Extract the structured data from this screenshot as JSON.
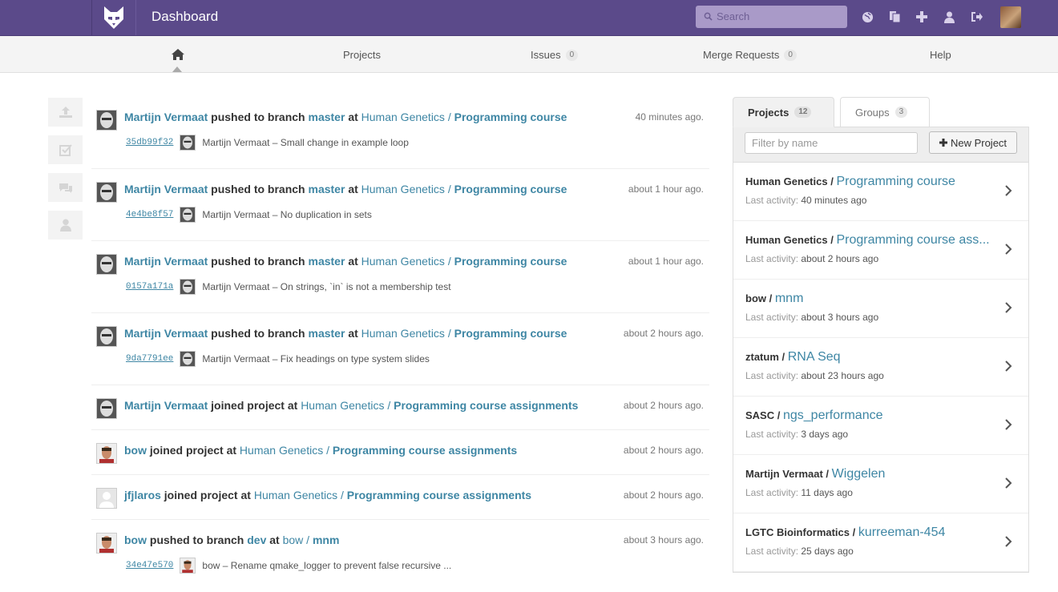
{
  "app": {
    "title": "Dashboard"
  },
  "search": {
    "placeholder": "Search"
  },
  "nav": {
    "items": [
      {
        "label": "Projects"
      },
      {
        "label": "Issues",
        "count": "0"
      },
      {
        "label": "Merge Requests",
        "count": "0"
      },
      {
        "label": "Help"
      }
    ]
  },
  "events": [
    {
      "user": "Martijn Vermaat",
      "action": "pushed to branch",
      "branch": "master",
      "at": "at",
      "namespace": "Human Genetics /",
      "project": "Programming course",
      "time": "40 minutes ago.",
      "sha": "35db99f32",
      "commit_author": "Martijn Vermaat",
      "commit_msg": "Small change in example loop"
    },
    {
      "user": "Martijn Vermaat",
      "action": "pushed to branch",
      "branch": "master",
      "at": "at",
      "namespace": "Human Genetics /",
      "project": "Programming course",
      "time": "about 1 hour ago.",
      "sha": "4e4be8f57",
      "commit_author": "Martijn Vermaat",
      "commit_msg": "No duplication in sets"
    },
    {
      "user": "Martijn Vermaat",
      "action": "pushed to branch",
      "branch": "master",
      "at": "at",
      "namespace": "Human Genetics /",
      "project": "Programming course",
      "time": "about 1 hour ago.",
      "sha": "0157a171a",
      "commit_author": "Martijn Vermaat",
      "commit_msg": "On strings, `in` is not a membership test"
    },
    {
      "user": "Martijn Vermaat",
      "action": "pushed to branch",
      "branch": "master",
      "at": "at",
      "namespace": "Human Genetics /",
      "project": "Programming course",
      "time": "about 2 hours ago.",
      "sha": "9da7791ee",
      "commit_author": "Martijn Vermaat",
      "commit_msg": "Fix headings on type system slides"
    },
    {
      "user": "Martijn Vermaat",
      "action": "joined project",
      "at": "at",
      "namespace": "Human Genetics /",
      "project": "Programming course assignments",
      "time": "about 2 hours ago."
    },
    {
      "user": "bow",
      "action": "joined project",
      "at": "at",
      "namespace": "Human Genetics /",
      "project": "Programming course assignments",
      "time": "about 2 hours ago."
    },
    {
      "user": "jfjlaros",
      "action": "joined project",
      "at": "at",
      "namespace": "Human Genetics /",
      "project": "Programming course assignments",
      "time": "about 2 hours ago."
    },
    {
      "user": "bow",
      "action": "pushed to branch",
      "branch": "dev",
      "at": "at",
      "namespace": "bow /",
      "project": "mnm",
      "time": "about 3 hours ago.",
      "sha": "34e47e570",
      "commit_author": "bow",
      "commit_msg": "Rename qmake_logger to prevent false recursive ..."
    }
  ],
  "sidebar": {
    "tab_projects": "Projects",
    "tab_projects_count": "12",
    "tab_groups": "Groups",
    "tab_groups_count": "3",
    "filter_placeholder": "Filter by name",
    "new_project_label": "New Project",
    "activity_label": "Last activity:",
    "projects": [
      {
        "namespace": "Human Genetics /",
        "name": "Programming course",
        "activity": "40 minutes ago"
      },
      {
        "namespace": "Human Genetics /",
        "name": "Programming course ass...",
        "activity": "about 2 hours ago"
      },
      {
        "namespace": "bow /",
        "name": "mnm",
        "activity": "about 3 hours ago"
      },
      {
        "namespace": "ztatum /",
        "name": "RNA Seq",
        "activity": "about 23 hours ago"
      },
      {
        "namespace": "SASC /",
        "name": "ngs_performance",
        "activity": "3 days ago"
      },
      {
        "namespace": "Martijn Vermaat /",
        "name": "Wiggelen",
        "activity": "11 days ago"
      },
      {
        "namespace": "LGTC Bioinformatics /",
        "name": "kurreeman-454",
        "activity": "25 days ago"
      }
    ]
  },
  "colors": {
    "topbar": "#5b4a8a",
    "link": "#3e86a4"
  }
}
